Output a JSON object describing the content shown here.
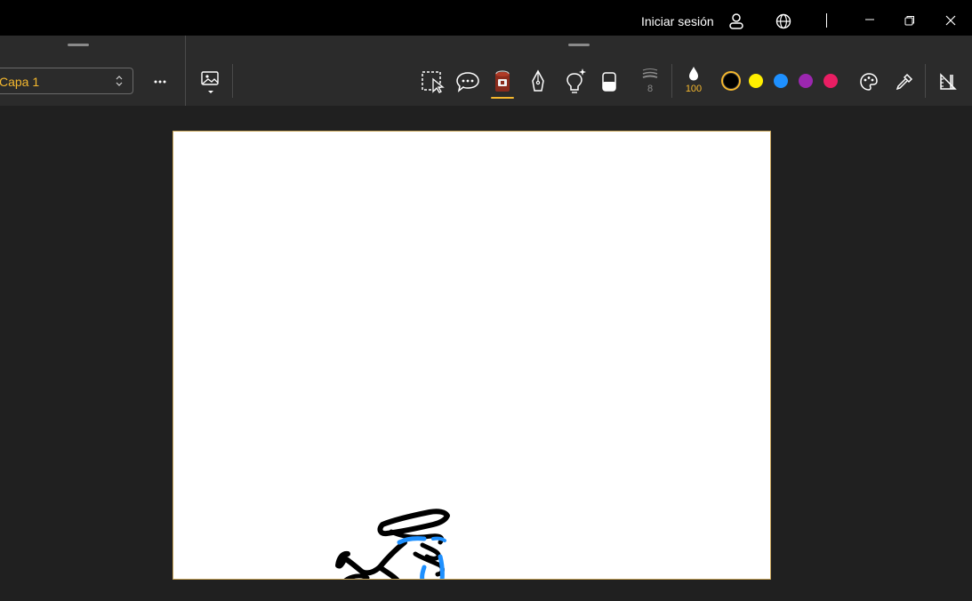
{
  "titlebar": {
    "signin_label": "Iniciar sesión",
    "icons": [
      "person-icon",
      "globe-icon",
      "minimize-icon",
      "restore-icon",
      "close-icon"
    ]
  },
  "toolbar": {
    "layer": {
      "selected": "Capa 1"
    },
    "more_icon": "more-icon",
    "insert_image_icon": "insert-image-icon",
    "tools": [
      {
        "name": "selection-tool",
        "active": false
      },
      {
        "name": "text-tool",
        "active": false
      },
      {
        "name": "fill-bucket-tool",
        "active": true
      },
      {
        "name": "pen-tool",
        "active": false
      },
      {
        "name": "glow-tool",
        "active": false
      },
      {
        "name": "eraser-tool",
        "active": false
      }
    ],
    "stroke_size": "8",
    "opacity": "100",
    "colors": {
      "selected": "#000000",
      "palette": [
        "#000000",
        "#ffef00",
        "#1e90ff",
        "#9b27af",
        "#e91e63"
      ]
    },
    "accent": "#f5b82e"
  }
}
